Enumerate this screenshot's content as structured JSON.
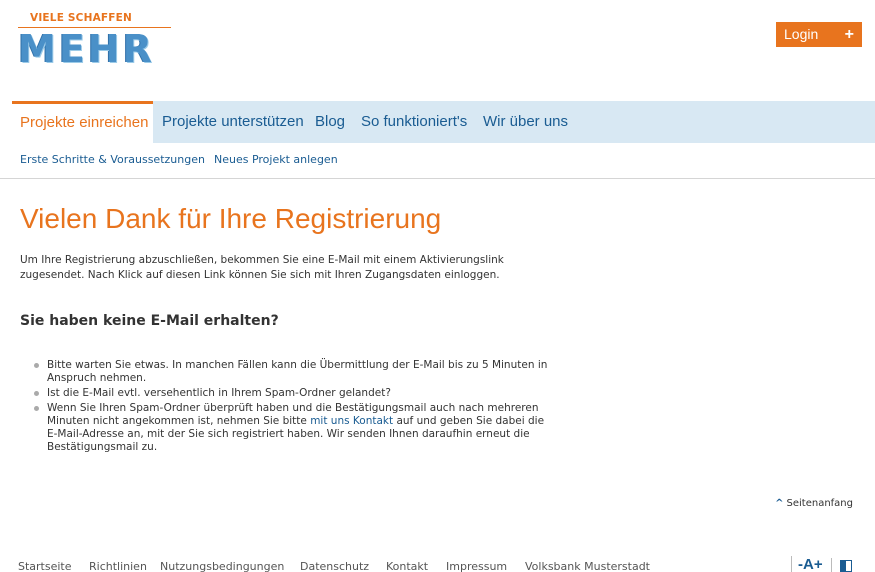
{
  "logo": {
    "tagline": "VIELE SCHAFFEN",
    "wordmark": "MEHR"
  },
  "header": {
    "login_label": "Login",
    "login_plus": "+"
  },
  "mainnav": {
    "items": [
      {
        "label": "Projekte einreichen",
        "active": true
      },
      {
        "label": "Projekte unterstützen"
      },
      {
        "label": "Blog"
      },
      {
        "label": "So funktioniert's"
      },
      {
        "label": "Wir über uns"
      }
    ]
  },
  "subnav": {
    "items": [
      "Erste Schritte & Voraussetzungen",
      "Neues Projekt anlegen"
    ]
  },
  "content": {
    "title": "Vielen Dank für Ihre Registrierung",
    "intro": "Um Ihre Registrierung abzuschließen, bekommen Sie eine E-Mail mit einem Aktivierungslink zugesendet. Nach Klick auf diesen Link können Sie sich mit Ihren Zugangsdaten einloggen.",
    "subtitle": "Sie haben keine E-Mail erhalten?",
    "tips": [
      "Bitte warten Sie etwas. In manchen Fällen kann die Übermittlung der E-Mail bis zu 5 Minuten in Anspruch nehmen.",
      "Ist die E-Mail evtl. versehentlich in Ihrem Spam-Ordner gelandet?"
    ],
    "tip3_before": "Wenn Sie Ihren Spam-Ordner überprüft haben und die Bestätigungsmail auch nach mehreren Minuten nicht angekommen ist, nehmen Sie bitte ",
    "tip3_link": "mit uns Kontakt",
    "tip3_after": " auf und geben Sie dabei die E-Mail-Adresse an, mit der Sie sich registriert haben. Wir senden Ihnen daraufhin erneut die Bestätigungsmail zu."
  },
  "back_to_top": "Seitenanfang",
  "footer": {
    "links": [
      "Startseite",
      "Richtlinien",
      "Nutzungsbedingungen",
      "Datenschutz",
      "Kontakt",
      "Impressum",
      "Volksbank Musterstadt"
    ],
    "font_size_control": "-A+"
  },
  "colors": {
    "accent": "#e8741e",
    "link": "#1a5c92",
    "nav_bg": "#d8e8f3"
  },
  "icons": {
    "back_to_top": "caret-up-icon",
    "contrast": "contrast-icon",
    "login": "plus-icon"
  }
}
